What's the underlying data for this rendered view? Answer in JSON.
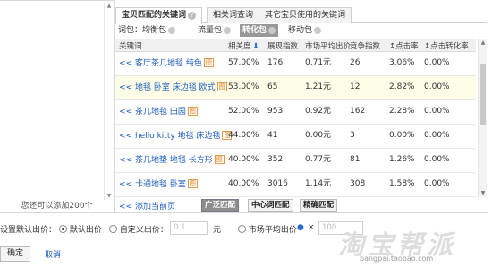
{
  "left_panel": {
    "hint": "您还可以添加200个"
  },
  "tabs": [
    {
      "label": "宝贝匹配的关键词",
      "help": "?"
    },
    {
      "label": "相关词查询"
    },
    {
      "label": "其它宝贝使用的关键词"
    }
  ],
  "packages": {
    "prefix": "词包：",
    "items": [
      "均衡包",
      "流量包",
      "转化包",
      "移动包"
    ]
  },
  "table": {
    "headers": {
      "keyword": "关键词",
      "relevance": "相关度",
      "impressions": "展现指数",
      "avg_bid": "市场平均出价",
      "competition": "竞争指数",
      "ctr": "点击率",
      "cvr": "点击转化率"
    },
    "rows": [
      {
        "prefix": "<<",
        "kw_line1": "客厅茶几地毯 纯色",
        "kw_line2": "",
        "badge": "图",
        "relevance": "57.00%",
        "impressions": "176",
        "avg_bid": "0.71元",
        "competition": "26",
        "ctr": "3.06%",
        "cvr": "0.00%"
      },
      {
        "prefix": "<<",
        "kw_line1": "地毯 卧室 床边毯 欧式",
        "kw_line2": "",
        "badge": "图",
        "relevance": "53.00%",
        "impressions": "65",
        "avg_bid": "1.21元",
        "competition": "12",
        "ctr": "2.82%",
        "cvr": "0.00%"
      },
      {
        "prefix": "<<",
        "kw_line1": "茶几地毯 田园",
        "kw_line2": "",
        "badge": "图",
        "relevance": "52.00%",
        "impressions": "953",
        "avg_bid": "0.92元",
        "competition": "162",
        "ctr": "2.28%",
        "cvr": "0.00%"
      },
      {
        "prefix": "<<",
        "kw_line1": "hello kitty 地毯 床边毯",
        "kw_line2": "",
        "badge": "图",
        "relevance": "44.00%",
        "impressions": "41",
        "avg_bid": "0.00元",
        "competition": "3",
        "ctr": "0.00%",
        "cvr": "0.00%"
      },
      {
        "prefix": "<<",
        "kw_line1": "茶几地垫 地毯 长方形",
        "kw_line2": "",
        "badge": "图",
        "relevance": "40.00%",
        "impressions": "352",
        "avg_bid": "0.77元",
        "competition": "81",
        "ctr": "1.26%",
        "cvr": "0.00%"
      },
      {
        "prefix": "<<",
        "kw_line1": "卡通地毯 卧室",
        "kw_line2": "",
        "badge": "图",
        "relevance": "40.00%",
        "impressions": "3016",
        "avg_bid": "1.14元",
        "competition": "308",
        "ctr": "1.58%",
        "cvr": "0.00%"
      }
    ]
  },
  "footer": {
    "add_page": "<< 添加当前页",
    "modes": [
      "广泛匹配",
      "中心词匹配",
      "精确匹配"
    ]
  },
  "bid": {
    "label": "设置默认出价：",
    "option_default": "默认出价",
    "option_custom": "自定义出价：",
    "custom_value": "0.1",
    "unit": "元",
    "option_market": "市场平均出价",
    "market_x": "×",
    "market_value": "100"
  },
  "actions": {
    "ok": "确定",
    "cancel": "取消"
  },
  "watermark": {
    "text": "淘宝帮派",
    "url": "bangpai.taobao.com"
  }
}
